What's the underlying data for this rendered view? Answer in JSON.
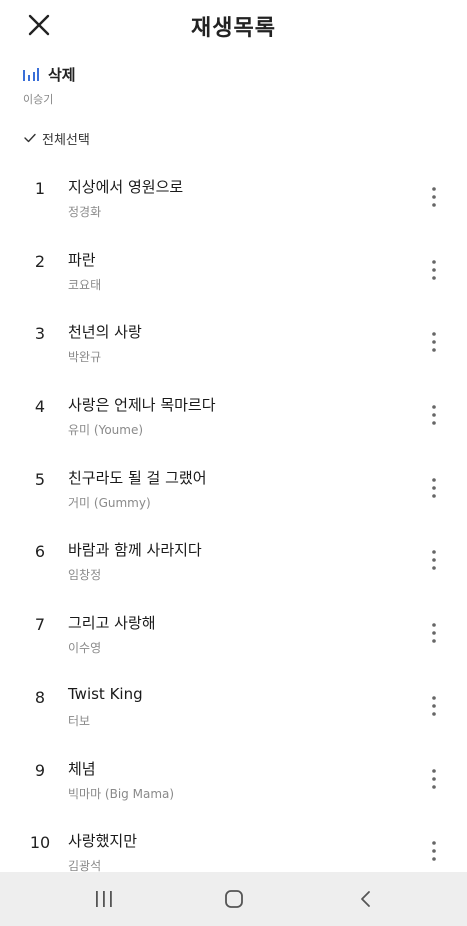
{
  "header": {
    "title": "재생목록",
    "close_icon": "close-icon"
  },
  "now_playing": {
    "icon": "equalizer-icon",
    "accent_color": "#3a6fd8",
    "title": "삭제",
    "artist": "이승기"
  },
  "select_all": {
    "icon": "check-icon",
    "label": "전체선택"
  },
  "songs": [
    {
      "num": "1",
      "title": "지상에서 영원으로",
      "artist": "정경화"
    },
    {
      "num": "2",
      "title": "파란",
      "artist": "코요태"
    },
    {
      "num": "3",
      "title": "천년의 사랑",
      "artist": "박완규"
    },
    {
      "num": "4",
      "title": "사랑은 언제나 목마르다",
      "artist": "유미 (Youme)"
    },
    {
      "num": "5",
      "title": "친구라도 될 걸 그랬어",
      "artist": "거미 (Gummy)"
    },
    {
      "num": "6",
      "title": "바람과 함께 사라지다",
      "artist": "임창정"
    },
    {
      "num": "7",
      "title": "그리고 사랑해",
      "artist": "이수영"
    },
    {
      "num": "8",
      "title": "Twist King",
      "artist": "터보"
    },
    {
      "num": "9",
      "title": "체념",
      "artist": "빅마마 (Big Mama)"
    },
    {
      "num": "10",
      "title": "사랑했지만",
      "artist": "김광석"
    }
  ],
  "nav": {
    "recents_icon": "recents-icon",
    "home_icon": "home-icon",
    "back_icon": "back-icon",
    "background": "#eeeeee"
  }
}
